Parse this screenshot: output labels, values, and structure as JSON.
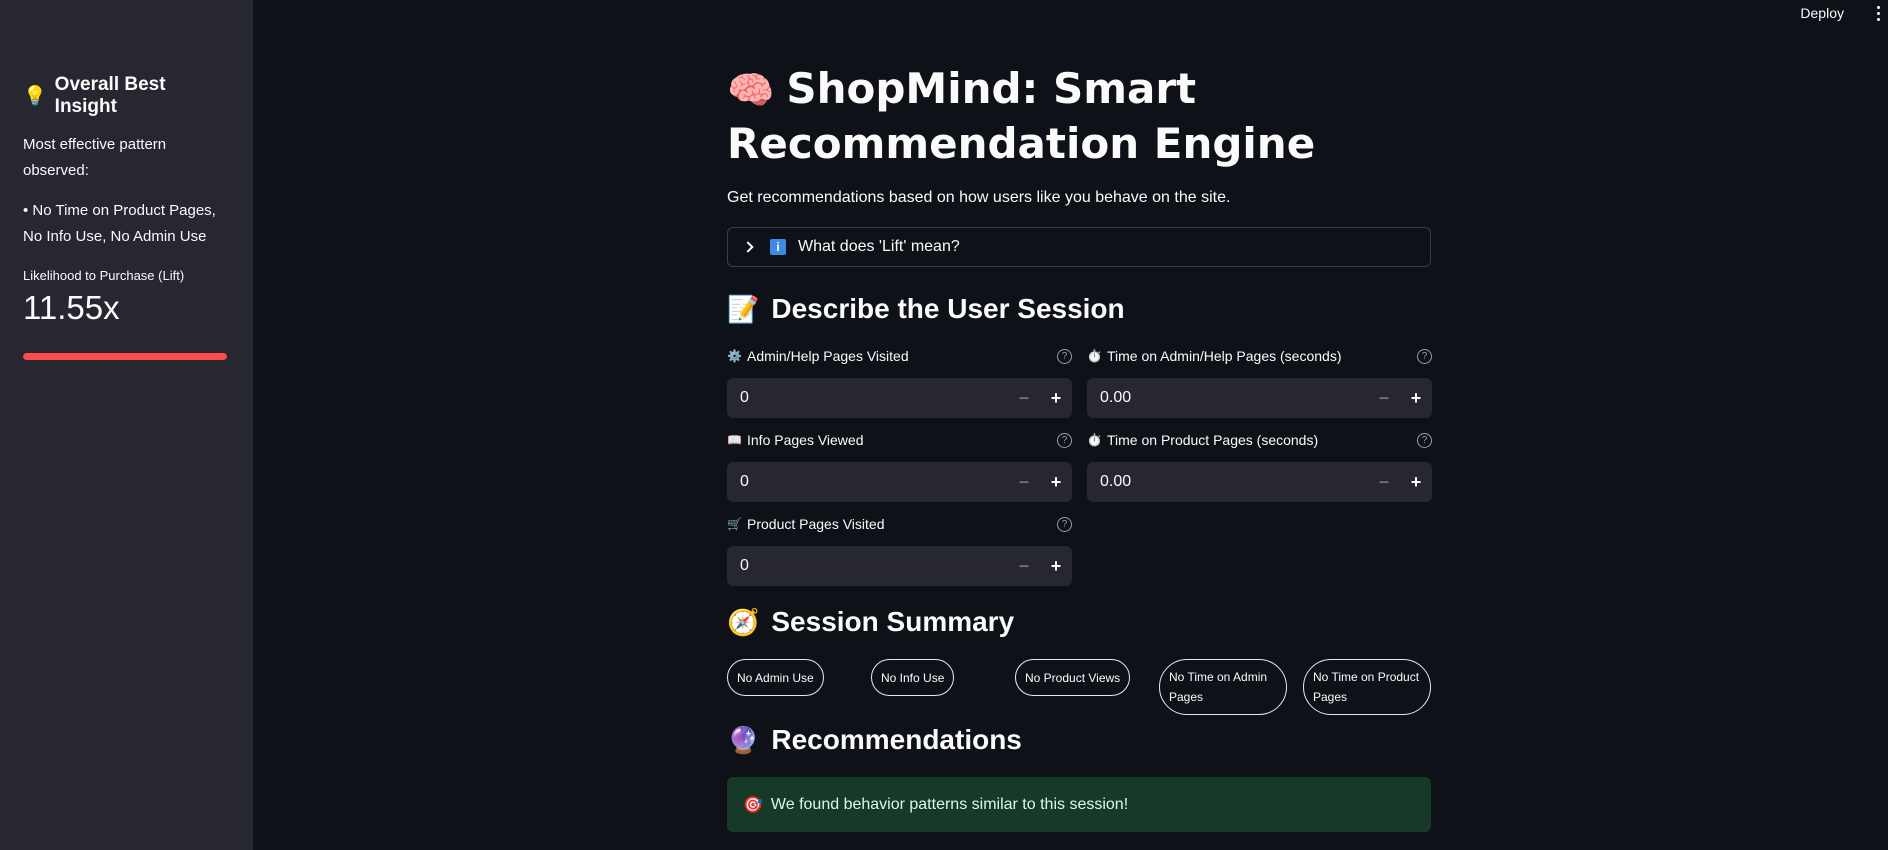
{
  "sidebar": {
    "title_icon": "lightbulb-icon",
    "title_emoji": "💡",
    "title": "Overall Best Insight",
    "text": "Most effective pattern observed:",
    "pattern": "• No Time on Product Pages, No Info Use, No Admin Use",
    "metric_label": "Likelihood to Purchase (Lift)",
    "metric_value": "11.55x",
    "progress_fraction": 1.0,
    "progress_color": "#ff4b4b"
  },
  "topbar": {
    "deploy_label": "Deploy",
    "menu_icon": "kebab-menu-icon"
  },
  "main": {
    "title_emoji": "🧠",
    "title": "ShopMind: Smart Recommendation Engine",
    "subtitle": "Get recommendations based on how users like you behave on the site.",
    "expander_label": "What does 'Lift' mean?",
    "expander_badge": "i",
    "describe_emoji": "📝",
    "describe_heading": "Describe the User Session",
    "fields": [
      {
        "icon": "⚙️",
        "label": "Admin/Help Pages Visited",
        "value": "0"
      },
      {
        "icon": "⏱️",
        "label": "Time on Admin/Help Pages (seconds)",
        "value": "0.00"
      },
      {
        "icon": "📖",
        "label": "Info Pages Viewed",
        "value": "0"
      },
      {
        "icon": "⏱️",
        "label": "Time on Product Pages (seconds)",
        "value": "0.00"
      },
      {
        "icon": "🛒",
        "label": "Product Pages Visited",
        "value": "0"
      }
    ],
    "help_glyph": "?",
    "minus_glyph": "−",
    "plus_glyph": "+",
    "summary_emoji": "🧭",
    "summary_heading": "Session Summary",
    "pills": [
      "No Admin Use",
      "No Info Use",
      "No Product Views",
      "No Time on Admin Pages",
      "No Time on Product Pages"
    ],
    "reco_emoji": "🔮",
    "reco_heading": "Recommendations",
    "alert_emoji": "🎯",
    "alert_text": "We found behavior patterns similar to this session!"
  }
}
